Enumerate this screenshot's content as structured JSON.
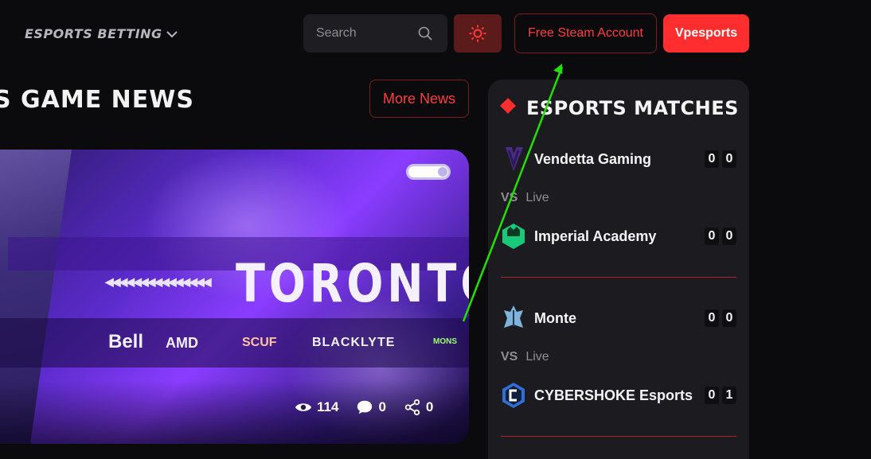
{
  "header": {
    "nav_label": "ESPORTS BETTING",
    "search_placeholder": "Search",
    "steam_button": "Free Steam Account",
    "brand_button": "Vpesports",
    "accent_color": "#ff2e2e"
  },
  "news": {
    "title": "S GAME NEWS",
    "more_button": "More News",
    "card": {
      "headline": "TORONTO KO",
      "arrow_strip": "◀◀◀◀◀◀◀◀◀◀◀◀◀◀◀",
      "sponsors": [
        "Bell",
        "AMD",
        "SCUF",
        "BLACKLYTE",
        "MONS"
      ],
      "views": "114",
      "comments": "0",
      "shares": "0"
    }
  },
  "matches": {
    "title": "ESPORTS MATCHES",
    "list": [
      {
        "team1": {
          "name": "Vendetta Gaming",
          "score": [
            "0",
            "0"
          ],
          "icon": "vendetta-logo"
        },
        "vs": "VS",
        "status": "Live",
        "team2": {
          "name": "Imperial Academy",
          "score": [
            "0",
            "0"
          ],
          "icon": "imperial-logo"
        }
      },
      {
        "team1": {
          "name": "Monte",
          "score": [
            "0",
            "0"
          ],
          "icon": "monte-logo"
        },
        "vs": "VS",
        "status": "Live",
        "team2": {
          "name": "CYBERSHOKE Esports",
          "score": [
            "0",
            "1"
          ],
          "icon": "cybershoke-logo"
        }
      }
    ]
  }
}
